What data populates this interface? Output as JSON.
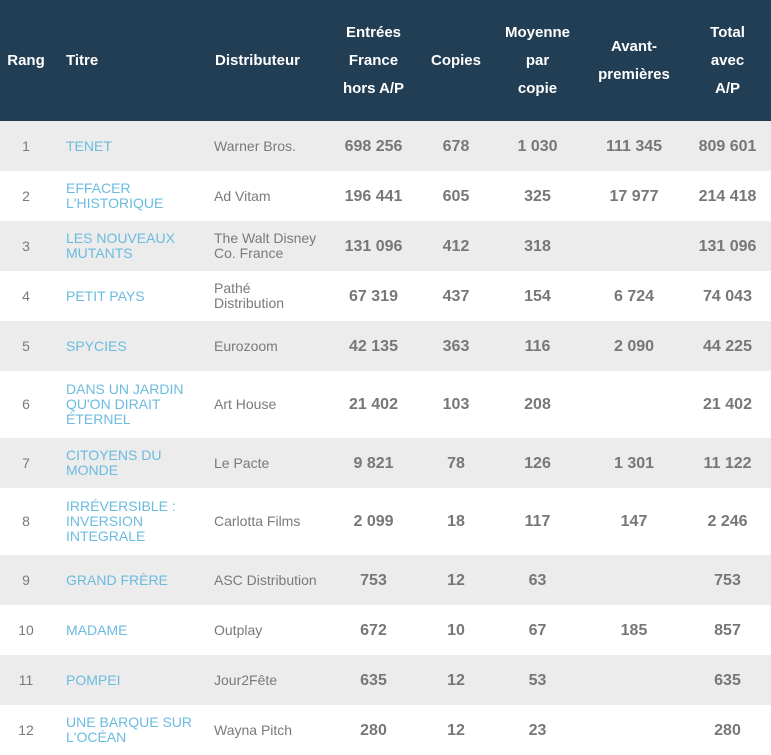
{
  "colors": {
    "header_bg": "#213e55",
    "header_text": "#ffffff",
    "row_alt_bg": "#ececec",
    "title_link": "#6bbbe0",
    "body_text": "#777777"
  },
  "table": {
    "headers": {
      "rang": "Rang",
      "titre": "Titre",
      "distributeur": "Distributeur",
      "entrees_l1": "Entrées",
      "entrees_l2": "France",
      "entrees_l3": "hors A/P",
      "copies": "Copies",
      "moyenne_l1": "Moyenne",
      "moyenne_l2": "par",
      "moyenne_l3": "copie",
      "avant_l1": "Avant-",
      "avant_l2": "premières",
      "total_l1": "Total",
      "total_l2": "avec",
      "total_l3": "A/P"
    },
    "rows": [
      {
        "rang": "1",
        "titre": "TENET",
        "distributeur": "Warner Bros.",
        "entrees": "698 256",
        "copies": "678",
        "moyenne": "1 030",
        "avant": "111 345",
        "total": "809 601"
      },
      {
        "rang": "2",
        "titre": "EFFACER L'HISTORIQUE",
        "distributeur": "Ad Vitam",
        "entrees": "196 441",
        "copies": "605",
        "moyenne": "325",
        "avant": "17 977",
        "total": "214 418"
      },
      {
        "rang": "3",
        "titre": "LES NOUVEAUX MUTANTS",
        "distributeur": "The Walt Disney Co. France",
        "entrees": "131 096",
        "copies": "412",
        "moyenne": "318",
        "avant": "",
        "total": "131 096"
      },
      {
        "rang": "4",
        "titre": "PETIT PAYS",
        "distributeur": "Pathé Distribution",
        "entrees": "67 319",
        "copies": "437",
        "moyenne": "154",
        "avant": "6 724",
        "total": "74 043"
      },
      {
        "rang": "5",
        "titre": "SPYCIES",
        "distributeur": "Eurozoom",
        "entrees": "42 135",
        "copies": "363",
        "moyenne": "116",
        "avant": "2 090",
        "total": "44 225"
      },
      {
        "rang": "6",
        "titre": "DANS UN JARDIN QU'ON DIRAIT ÉTERNEL",
        "distributeur": "Art House",
        "entrees": "21 402",
        "copies": "103",
        "moyenne": "208",
        "avant": "",
        "total": "21 402"
      },
      {
        "rang": "7",
        "titre": "CITOYENS DU MONDE",
        "distributeur": "Le Pacte",
        "entrees": "9 821",
        "copies": "78",
        "moyenne": "126",
        "avant": "1 301",
        "total": "11 122"
      },
      {
        "rang": "8",
        "titre": "IRRÉVERSIBLE : INVERSION INTEGRALE",
        "distributeur": "Carlotta Films",
        "entrees": "2 099",
        "copies": "18",
        "moyenne": "117",
        "avant": "147",
        "total": "2 246"
      },
      {
        "rang": "9",
        "titre": "GRAND FRÈRE",
        "distributeur": "ASC Distribution",
        "entrees": "753",
        "copies": "12",
        "moyenne": "63",
        "avant": "",
        "total": "753"
      },
      {
        "rang": "10",
        "titre": "MADAME",
        "distributeur": "Outplay",
        "entrees": "672",
        "copies": "10",
        "moyenne": "67",
        "avant": "185",
        "total": "857"
      },
      {
        "rang": "11",
        "titre": "POMPEI",
        "distributeur": "Jour2Fête",
        "entrees": "635",
        "copies": "12",
        "moyenne": "53",
        "avant": "",
        "total": "635"
      },
      {
        "rang": "12",
        "titre": "UNE BARQUE SUR L'OCÉAN",
        "distributeur": "Wayna Pitch",
        "entrees": "280",
        "copies": "12",
        "moyenne": "23",
        "avant": "",
        "total": "280"
      }
    ]
  }
}
